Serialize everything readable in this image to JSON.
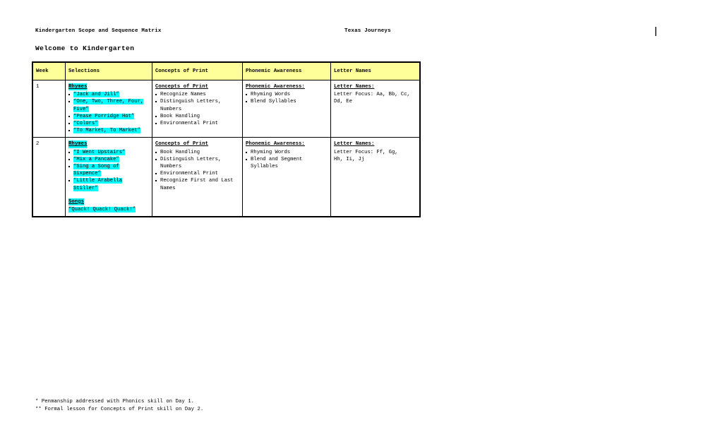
{
  "document": {
    "running_head_left": "Kindergarten Scope and Sequence Matrix",
    "running_head_right": "Texas Journeys",
    "unit_title": "Welcome to Kindergarten"
  },
  "table": {
    "columns": [
      "Week",
      "Selections",
      "Concepts of Print",
      "Phonemic Awareness",
      "Letter Names"
    ],
    "rows": [
      {
        "week": "1",
        "selections": {
          "heading": "Rhymes",
          "items": [
            "“Jack and Jill”",
            "“One, Two, Three, Four, Five”",
            "“Pease Porridge Hot”",
            "“Colors”",
            "“To Market, To Market”"
          ],
          "songs_heading": "",
          "songs_items": []
        },
        "concepts_of_print": {
          "heading": "Concepts of Print",
          "items": [
            "Recognize Names",
            "Distinguish Letters, Numbers",
            "Book Handling",
            "Environmental Print"
          ]
        },
        "phonemic_awareness": {
          "heading": "Phonemic Awareness:",
          "items": [
            "Rhyming Words",
            "Blend Syllables"
          ]
        },
        "letter_names": {
          "heading": "Letter Names:",
          "lines": [
            "Letter Focus: Aa, Bb, Cc,",
            "Dd, Ee"
          ]
        }
      },
      {
        "week": "2",
        "selections": {
          "heading": "Rhymes",
          "items": [
            "“I Went Upstairs”",
            "“Mix a Pancake”",
            "“Sing a Song of Sixpence”",
            "“Little Arabella Stiller”"
          ],
          "songs_heading": "Songs",
          "songs_items": [
            "“Quack! Quack! Quack!”"
          ]
        },
        "concepts_of_print": {
          "heading": "Concepts of Print",
          "items": [
            "Book Handling",
            "Distinguish Letters, Numbers",
            "Environmental Print",
            "Recognize First and Last Names"
          ]
        },
        "phonemic_awareness": {
          "heading": "Phonemic Awareness:",
          "items": [
            "Rhyming Words",
            "Blend and Segment Syllables"
          ]
        },
        "letter_names": {
          "heading": "Letter Names:",
          "lines": [
            "Letter Focus: Ff, Gg,",
            "Hh, Ii, Jj"
          ]
        }
      }
    ]
  },
  "footnotes": [
    "*  Penmanship addressed with Phonics skill on Day 1.",
    "** Formal lesson for Concepts of Print skill on Day 2."
  ],
  "colors": {
    "header_fill": "#ffff99",
    "highlight": "#00ffff",
    "border": "#000000",
    "page": "#ffffff"
  }
}
